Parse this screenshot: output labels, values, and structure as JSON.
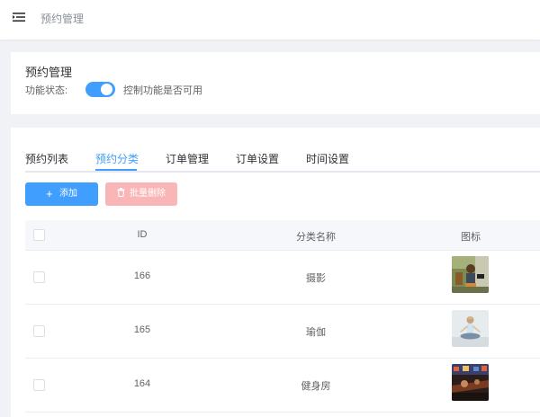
{
  "header": {
    "title": "预约管理"
  },
  "settings": {
    "title": "预约管理",
    "status_label": "功能状态:",
    "status_enabled": true,
    "status_desc": "控制功能是否可用"
  },
  "tabs": [
    {
      "label": "预约列表"
    },
    {
      "label": "预约分类"
    },
    {
      "label": "订单管理"
    },
    {
      "label": "订单设置"
    },
    {
      "label": "时间设置"
    }
  ],
  "active_tab": "预约分类",
  "toolbar": {
    "add_label": "添加",
    "batch_delete_label": "批量删除"
  },
  "table": {
    "columns": [
      "ID",
      "分类名称",
      "图标"
    ],
    "rows": [
      {
        "id": "166",
        "name": "摄影",
        "icon": "photography-image"
      },
      {
        "id": "165",
        "name": "瑜伽",
        "icon": "yoga-image"
      },
      {
        "id": "164",
        "name": "健身房",
        "icon": "gym-image"
      }
    ]
  },
  "colors": {
    "primary": "#409eff",
    "danger_disabled": "#fab6b6",
    "page_bg": "#f0f2f5"
  }
}
